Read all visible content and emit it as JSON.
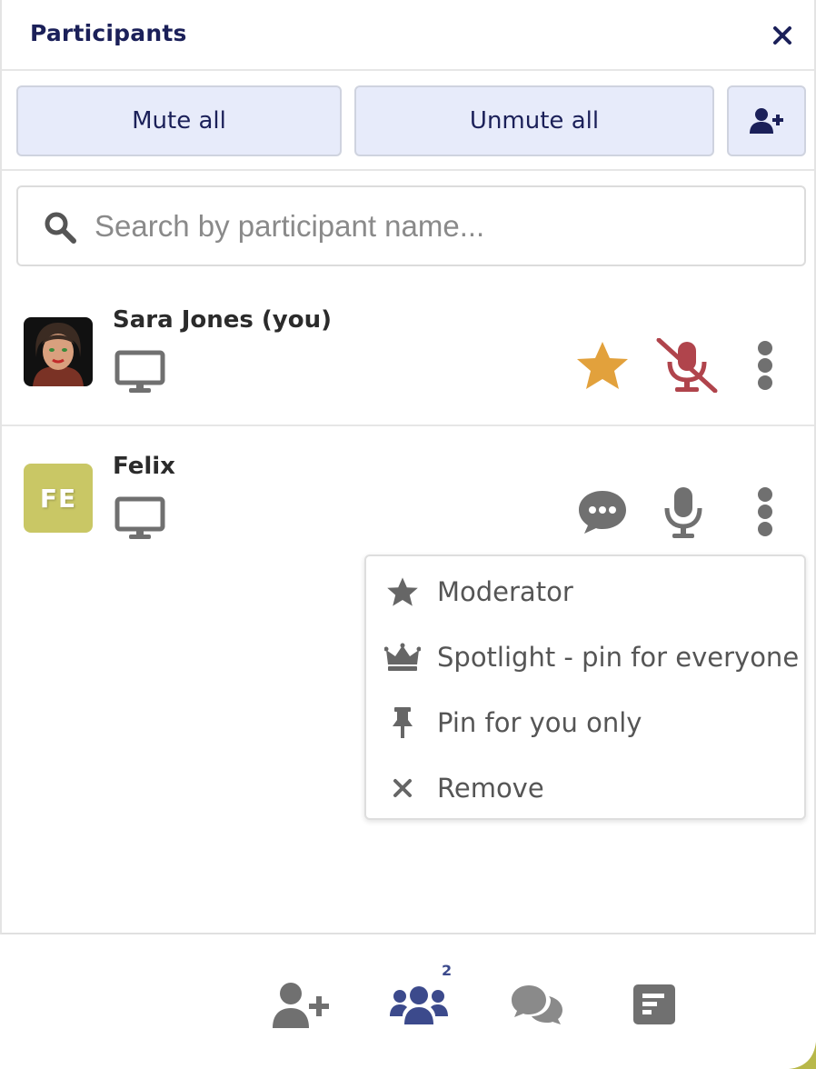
{
  "header": {
    "title": "Participants"
  },
  "actions": {
    "mute_all": "Mute all",
    "unmute_all": "Unmute all"
  },
  "search": {
    "placeholder": "Search by participant name..."
  },
  "participants": [
    {
      "name": "Sara Jones (you)",
      "role_icon": "star-icon",
      "mic": "muted",
      "colors": {
        "star": "#e2a13c",
        "mic_muted": "#b0444c"
      }
    },
    {
      "name": "Felix",
      "initials": "FE",
      "avatar_color": "#c9c765",
      "mic": "on"
    }
  ],
  "context_menu": {
    "items": [
      {
        "label": "Moderator",
        "icon": "star-icon"
      },
      {
        "label": "Spotlight - pin for everyone",
        "icon": "crown-icon"
      },
      {
        "label": "Pin for you only",
        "icon": "pin-icon"
      },
      {
        "label": "Remove",
        "icon": "x-icon"
      }
    ]
  },
  "bottom_bar": {
    "participants_count": "2"
  },
  "colors": {
    "accent": "#1b2059",
    "button_bg": "#e7ebfa",
    "active_nav": "#3c4a8c",
    "icon_gray": "#707070"
  }
}
